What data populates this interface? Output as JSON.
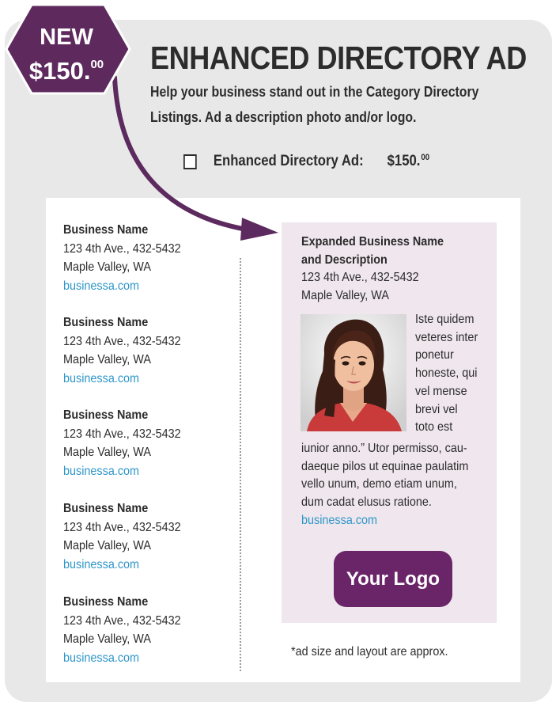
{
  "badge": {
    "new_label": "NEW",
    "price": "$150.",
    "cents": "00"
  },
  "header": {
    "title": "ENHANCED DIRECTORY AD",
    "subtitle_line1": "Help your business stand out in the Category Directory",
    "subtitle_line2": "Listings. Ad a description photo and/or logo."
  },
  "option": {
    "label": "Enhanced Directory Ad:",
    "price": "$150.",
    "cents": "00"
  },
  "listings": [
    {
      "name": "Business Name",
      "address": "123 4th Ave., 432-5432",
      "city": "Maple Valley, WA",
      "url": "businessa.com"
    },
    {
      "name": "Business Name",
      "address": "123 4th Ave., 432-5432",
      "city": "Maple Valley, WA",
      "url": "businessa.com"
    },
    {
      "name": "Business Name",
      "address": "123 4th Ave., 432-5432",
      "city": "Maple Valley, WA",
      "url": "businessa.com"
    },
    {
      "name": "Business Name",
      "address": "123 4th Ave., 432-5432",
      "city": "Maple Valley, WA",
      "url": "businessa.com"
    },
    {
      "name": "Business Name",
      "address": "123 4th Ave., 432-5432",
      "city": "Maple Valley, WA",
      "url": "businessa.com"
    }
  ],
  "featured": {
    "title_line1": "Expanded Business Name",
    "title_line2": "and Description",
    "address": "123 4th Ave., 432-5432",
    "city": "Maple Valley, WA",
    "wrap_lines": [
      "Iste quidem",
      "veteres inter",
      "ponetur",
      "honeste, qui",
      "vel mense",
      "brevi vel",
      "toto est"
    ],
    "body_lines": [
      "iunior anno.” Utor permisso, cau-",
      "daeque pilos ut equinae paulatim",
      "vello unum, demo etiam unum,",
      "dum cadat elusus ratione."
    ],
    "url": "businessa.com",
    "logo_label": "Your Logo"
  },
  "footnote": "*ad size and layout are approx.",
  "colors": {
    "accent": "#6a2468",
    "link": "#2e96c8",
    "panel": "#e8e8e8",
    "featured_bg": "#efe6ee"
  }
}
